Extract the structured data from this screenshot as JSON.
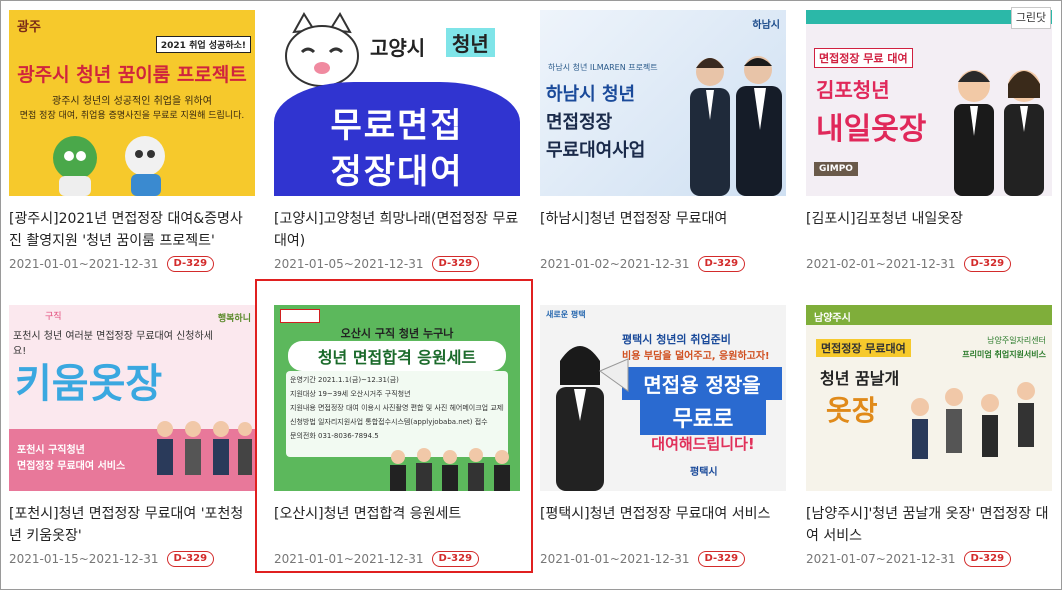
{
  "close_button": "그린닷",
  "cards": [
    {
      "title": "[광주시]2021년 면접정장 대여&증명사진 촬영지원 '청년 꿈이룸 프로젝트'",
      "date": "2021-01-01~2021-12-31",
      "dday": "D-329",
      "thumb": {
        "logo": "광주",
        "tag": "2021 취업 성공하소!",
        "headline": "광주시 청년 꿈이룸 프로젝트",
        "line1": "광주시 청년의 성공적인 취업을 위하여",
        "line2": "면접 정장 대여, 취업용 증명사진을 무료로 지원해 드립니다."
      }
    },
    {
      "title": "[고양시]고양청년 희망나래(면접정장 무료대여)",
      "date": "2021-01-05~2021-12-31",
      "dday": "D-329",
      "thumb": {
        "top1": "고양시",
        "top2": "청년",
        "line1": "무료면접",
        "line2": "정장대여"
      }
    },
    {
      "title": "[하남시]청년 면접정장 무료대여",
      "date": "2021-01-02~2021-12-31",
      "dday": "D-329",
      "thumb": {
        "brand": "하남시",
        "small": "하남시 청년 ILMAREN 프로젝트",
        "line1": "하남시 청년",
        "line2": "면접정장",
        "line3": "무료대여사업"
      }
    },
    {
      "title": "[김포시]김포청년 내일옷장",
      "date": "2021-02-01~2021-12-31",
      "dday": "D-329",
      "thumb": {
        "sub": "면접정장 무료 대여",
        "line1": "김포청년",
        "line2": "내일옷장",
        "logo": "GIMPO"
      }
    },
    {
      "title": "[포천시]청년 면접정장 무료대여 '포천청년 키움옷장'",
      "date": "2021-01-15~2021-12-31",
      "dday": "D-329",
      "thumb": {
        "note": "구직",
        "top": "포천시 청년 여러분 면접정장 무료대여 신청하세요!",
        "brand": "행복하니",
        "line1": "키움옷장",
        "bottom1": "포천시 구직청년",
        "bottom2": "면접정장 무료대여 서비스"
      }
    },
    {
      "title": "[오산시]청년 면접합격 응원세트",
      "date": "2021-01-01~2021-12-31",
      "dday": "D-329",
      "thumb": {
        "top": "오산시 구직 청년 누구나",
        "banner": "청년 면접합격 응원세트",
        "r1": "운영기간  2021.1.1(금)~12.31(금)",
        "r2": "지원대상  19~39세 오산시거주 구직청년",
        "r3": "지원내용  면접정장 대여 이용시 사진촬영 편합 및 사진 헤어메이크업 교제비",
        "r4": "신청방법  일자리지원사업 통합접수시스템(applyjobaba.net) 접수",
        "r5": "문의전화  031-8036-7894.5"
      }
    },
    {
      "title": "[평택시]청년 면접정장 무료대여 서비스",
      "date": "2021-01-01~2021-12-31",
      "dday": "D-329",
      "thumb": {
        "brand": "새로운 평택",
        "top1": "평택시 청년의 취업준비",
        "top2": "비용 부담을 덜어주고, 응원하고자!",
        "line1": "면접용 정장을",
        "line2": "무료로",
        "line3": "대여해드립니다!",
        "city": "평택시"
      }
    },
    {
      "title": "[남양주시]'청년 꿈날개 옷장' 면접정장 대여 서비스",
      "date": "2021-01-07~2021-12-31",
      "dday": "D-329",
      "thumb": {
        "brand": "남양주시",
        "sub": "면접정장 무료대여",
        "right1": "남양주일자리센터",
        "right2": "프리미엄 취업지원서비스",
        "line1": "청년 꿈날개",
        "line2": "옷장"
      }
    }
  ],
  "colors": {
    "accent_red": "#d32b2b",
    "highlight": "#e02020"
  }
}
